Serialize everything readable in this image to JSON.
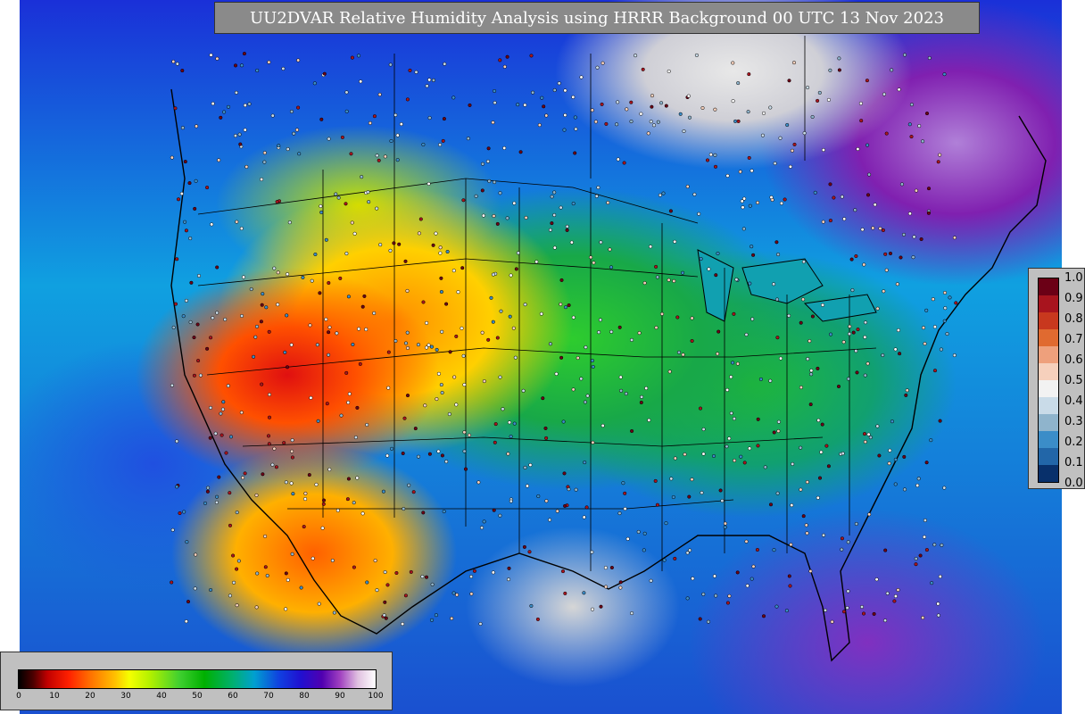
{
  "title": "UU2DVAR Relative Humidity Analysis using HRRR Background 00 UTC 13 Nov 2023",
  "map": {
    "field": "relative humidity",
    "overlays": [
      "state-borders",
      "coastlines",
      "observation-stations"
    ],
    "dominant_regions": {
      "southwest": "dry (red/orange)",
      "plains": "moist-moderate (green)",
      "oceans": "humid (blue/purple)",
      "canada-east": "very humid (purple/white)"
    }
  },
  "colorbar_observations": {
    "labels": [
      "1.0",
      "0.9",
      "0.8",
      "0.7",
      "0.6",
      "0.5",
      "0.4",
      "0.3",
      "0.2",
      "0.1",
      "0.0"
    ],
    "colors": [
      "#6b0016",
      "#a8141e",
      "#c8381e",
      "#e06a30",
      "#eea07c",
      "#f6d0bc",
      "#f2f2f2",
      "#c9dbe8",
      "#8fb4cc",
      "#3b8dc8",
      "#2266a8",
      "#08306b"
    ]
  },
  "colorbar_analysis": {
    "labels": [
      "0",
      "10",
      "20",
      "30",
      "40",
      "50",
      "60",
      "70",
      "80",
      "90",
      "100"
    ]
  }
}
